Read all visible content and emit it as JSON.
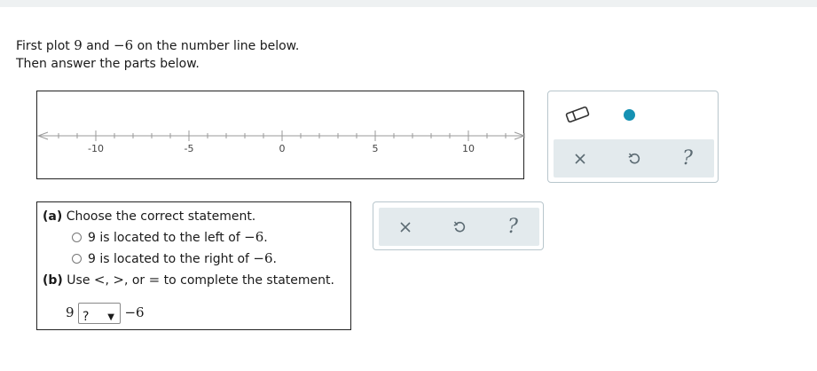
{
  "instructions": {
    "line1_pre": "First plot ",
    "line1_a": "9",
    "line1_mid": " and ",
    "line1_b": "−6",
    "line1_post": " on the number line below.",
    "line2": "Then answer the parts below."
  },
  "number_line": {
    "min": -12,
    "max": 13,
    "minor_step": 1,
    "major_step": 5,
    "labels": [
      "-10",
      "-5",
      "0",
      "5",
      "10"
    ],
    "label_values": [
      -10,
      -5,
      0,
      5,
      10
    ]
  },
  "graph_tools": {
    "eraser_icon": "eraser-icon",
    "point_tool_color": "#1591b3",
    "clear_icon": "x-icon",
    "undo_icon": "undo-icon",
    "help_label": "?"
  },
  "part_a": {
    "label": "(a)",
    "prompt": " Choose the correct statement.",
    "options": [
      {
        "pre": "9 is located to the left of ",
        "num": "−6",
        "post": "."
      },
      {
        "pre": "9 is located to the right of ",
        "num": "−6",
        "post": "."
      }
    ]
  },
  "part_b": {
    "label": "(b)",
    "prompt_pre": " Use ",
    "sym_lt": "<",
    "sep1": ", ",
    "sym_gt": ">",
    "sep2": ", or ",
    "sym_eq": "=",
    "prompt_post": " to complete the statement.",
    "left_value": "9",
    "select_value": "?",
    "select_arrow": "▼",
    "right_value": "−6"
  },
  "answer_tools": {
    "clear_icon": "x-icon",
    "undo_icon": "undo-icon",
    "help_label": "?"
  }
}
